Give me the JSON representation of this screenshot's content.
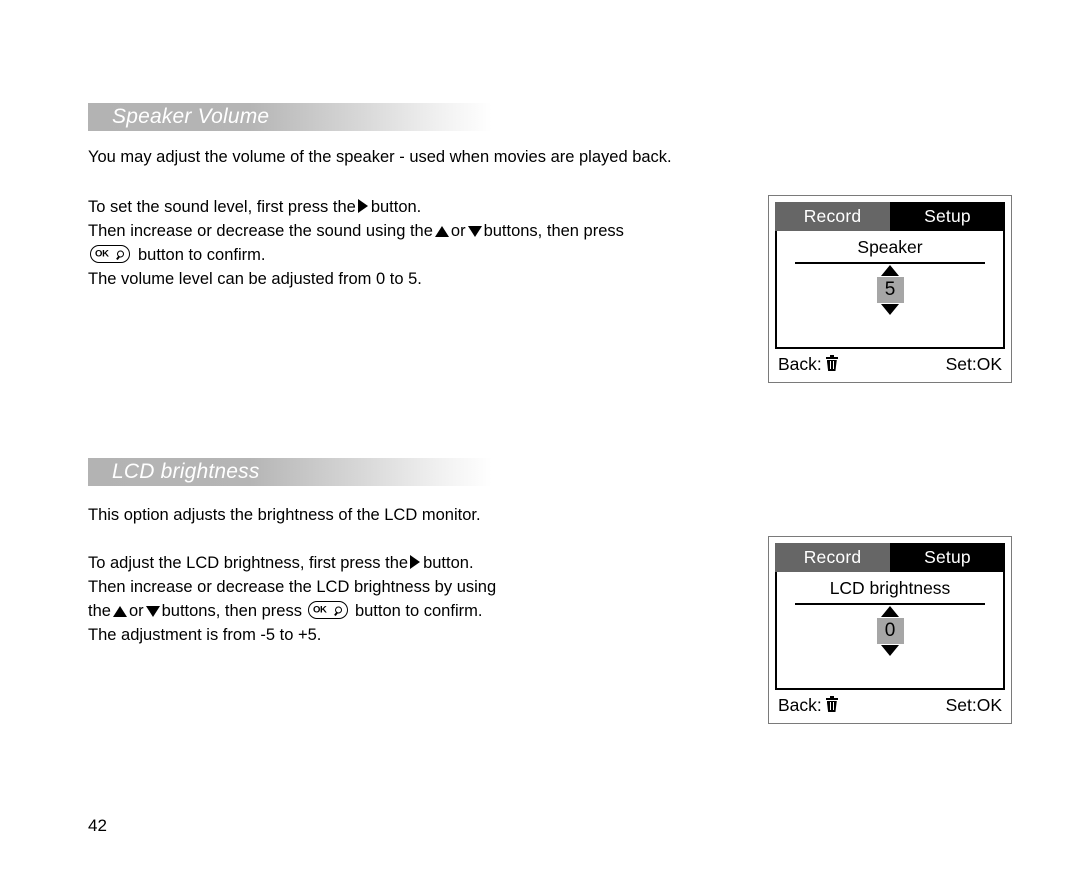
{
  "page": {
    "number": "42"
  },
  "sections": [
    {
      "heading": "Speaker Volume",
      "intro": "You may adjust the volume of the speaker - used when movies are played back.",
      "instructions": {
        "line1_a": "To set the sound level, first press the",
        "line1_b": "button.",
        "line2_a": "Then increase or decrease the sound using the",
        "line2_b": "or",
        "line2_c": "buttons, then press",
        "line3_ok": "OK",
        "line3_b": "button to confirm.",
        "line4": "The volume level can be adjusted from 0 to 5."
      },
      "lcd": {
        "tab_inactive": "Record",
        "tab_active": "Setup",
        "title": "Speaker",
        "value": "5",
        "footer_back_label": "Back:",
        "footer_set_label": "Set:OK"
      }
    },
    {
      "heading": "LCD brightness",
      "intro": "This option adjusts the brightness of the LCD monitor.",
      "instructions": {
        "line1_a": "To adjust the LCD brightness, first press the",
        "line1_b": "button.",
        "line2": "Then increase or decrease the LCD brightness by using",
        "line3_a": "the",
        "line3_b": "or",
        "line3_c": "buttons, then press",
        "line3_ok": "OK",
        "line3_d": "button to confirm.",
        "line4": "The adjustment is from -5 to +5."
      },
      "lcd": {
        "tab_inactive": "Record",
        "tab_active": "Setup",
        "title": "LCD brightness",
        "value": "0",
        "footer_back_label": "Back:",
        "footer_set_label": "Set:OK"
      }
    }
  ],
  "colors": {
    "banner_gray": "#b3b3b3",
    "tab_inactive": "#666666",
    "tab_active": "#000000",
    "value_highlight": "#a6a6a6",
    "frame_border": "#7a7a7a"
  }
}
